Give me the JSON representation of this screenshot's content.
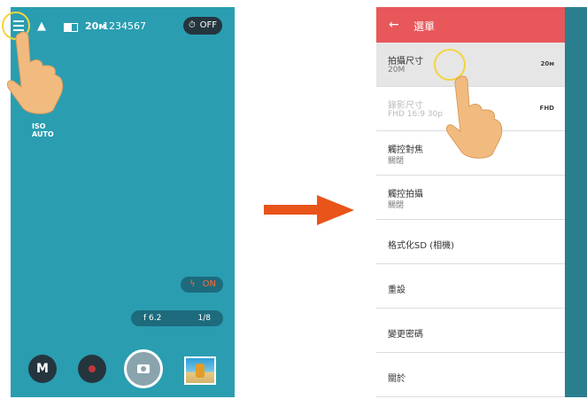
{
  "left_screen": {
    "status": {
      "size": "20м",
      "count": "1234567",
      "timer": "OFF"
    },
    "iso": {
      "label": "ISO",
      "value": "AUTO"
    },
    "flash": {
      "value": "ON"
    },
    "exposure": {
      "aperture": "f 6.2",
      "shutter": "1/8"
    },
    "mode_button": "M"
  },
  "right_screen": {
    "header_title": "選單",
    "items": [
      {
        "title": "拍攝尺寸",
        "sub": "20M",
        "badge": "20м"
      },
      {
        "title": "錄影尺寸",
        "sub": "FHD 16:9 30p",
        "badge": "FHD"
      },
      {
        "title": "觸控對焦",
        "sub": "關閉"
      },
      {
        "title": "觸控拍攝",
        "sub": "關閉"
      },
      {
        "title": "格式化SD (相機)"
      },
      {
        "title": "重設"
      },
      {
        "title": "變更密碼"
      },
      {
        "title": "關於"
      }
    ]
  },
  "colors": {
    "camera_bg": "#2a9db1",
    "header_red": "#e8575a",
    "arrow_orange": "#e8541a",
    "highlight_ring": "#f4d33c"
  }
}
